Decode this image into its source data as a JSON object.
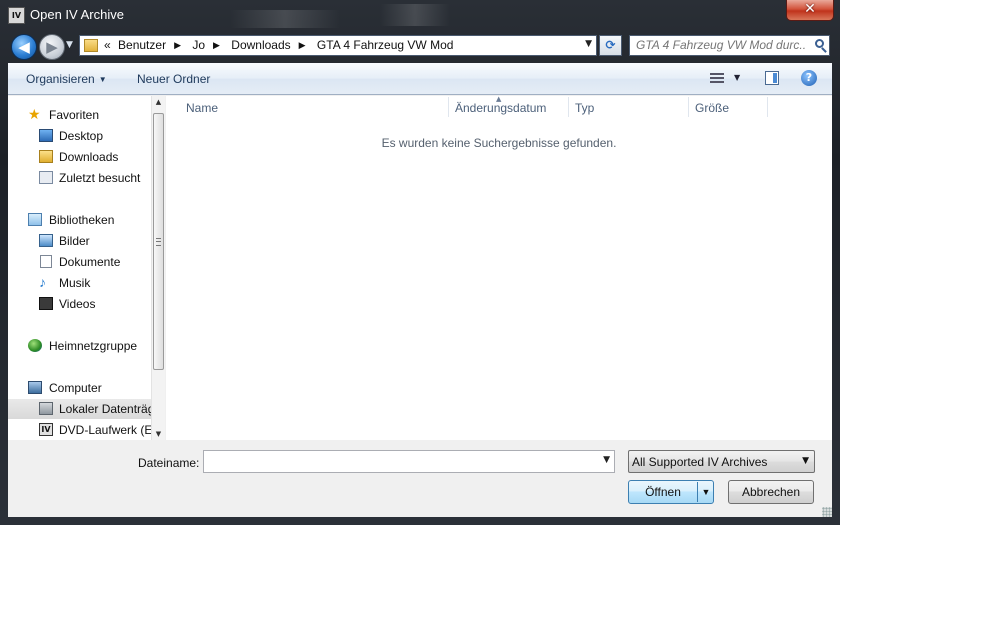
{
  "window": {
    "title": "Open IV Archive",
    "app_icon_text": "IV"
  },
  "navigation": {
    "breadcrumb": [
      "«",
      "Benutzer",
      "Jo",
      "Downloads",
      "GTA 4 Fahrzeug VW Mod"
    ],
    "search_placeholder": "GTA 4 Fahrzeug VW Mod durc..."
  },
  "toolbar": {
    "organize_label": "Organisieren",
    "new_folder_label": "Neuer Ordner",
    "help_label": "?"
  },
  "sidebar": {
    "items": [
      {
        "label": "Favoriten",
        "icon": "star-icon"
      },
      {
        "label": "Desktop",
        "icon": "desktop-icon"
      },
      {
        "label": "Downloads",
        "icon": "downloads-folder-icon"
      },
      {
        "label": "Zuletzt besucht",
        "icon": "recent-places-icon"
      },
      {
        "label": "Bibliotheken",
        "icon": "libraries-icon"
      },
      {
        "label": "Bilder",
        "icon": "pictures-icon"
      },
      {
        "label": "Dokumente",
        "icon": "documents-icon"
      },
      {
        "label": "Musik",
        "icon": "music-icon"
      },
      {
        "label": "Videos",
        "icon": "videos-icon"
      },
      {
        "label": "Heimnetzgruppe",
        "icon": "homegroup-icon"
      },
      {
        "label": "Computer",
        "icon": "computer-icon"
      },
      {
        "label": "Lokaler Datenträger",
        "icon": "local-disk-icon"
      },
      {
        "label": "DVD-Laufwerk (E",
        "icon": "dvd-drive-icon"
      }
    ]
  },
  "file_list": {
    "columns": [
      "Name",
      "Änderungsdatum",
      "Typ",
      "Größe"
    ],
    "empty_message": "Es wurden keine Suchergebnisse gefunden."
  },
  "footer": {
    "filename_label": "Dateiname:",
    "filename_value": "",
    "filter_value": "All Supported IV Archives",
    "open_label": "Öffnen",
    "cancel_label": "Abbrechen"
  },
  "colors": {
    "accent": "#3c7fb1",
    "close_button": "#c0331c"
  }
}
